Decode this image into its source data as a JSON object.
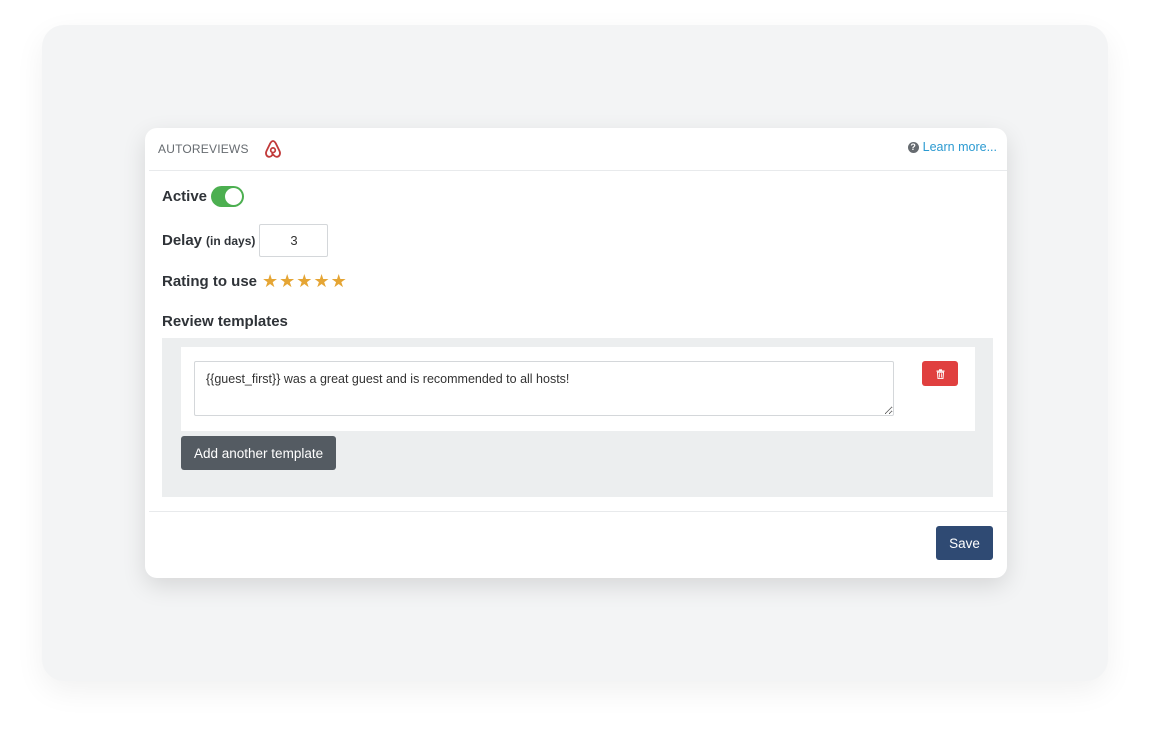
{
  "header": {
    "title": "AUTOREVIEWS",
    "brand_icon": "airbnb-icon",
    "learn_more": "Learn more...",
    "help_icon": "question-circle-icon"
  },
  "settings": {
    "active_label": "Active",
    "active_on": true,
    "delay_label": "Delay",
    "delay_unit": "(in days)",
    "delay_value": "3",
    "rating_label": "Rating to use",
    "rating_value": 5,
    "rating_max": 5
  },
  "templates": {
    "section_label": "Review templates",
    "items": [
      {
        "text": "{{guest_first}} was a great guest and is recommended to all hosts!"
      }
    ],
    "add_label": "Add another template",
    "delete_icon": "trash-icon"
  },
  "footer": {
    "save_label": "Save"
  },
  "colors": {
    "accent_green": "#4caf50",
    "star": "#e5a534",
    "danger": "#e0403f",
    "primary": "#2f4a73",
    "link": "#2b9ad1",
    "brand": "#c13a3a"
  }
}
